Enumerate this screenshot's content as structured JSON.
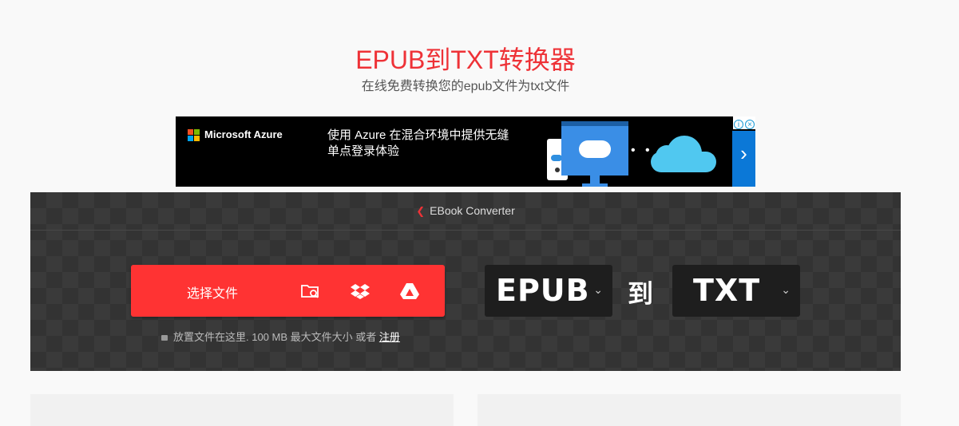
{
  "page": {
    "title": "EPUB到TXT转换器",
    "subtitle": "在线免费转换您的epub文件为txt文件"
  },
  "ad": {
    "brand": "Microsoft Azure",
    "text": "使用 Azure 在混合环境中提供无缝单点登录体验",
    "dots": "• • •",
    "arrow": "›",
    "logo_colors": [
      "#f25022",
      "#7fba00",
      "#00a4ef",
      "#ffb900"
    ]
  },
  "converter": {
    "breadcrumb": "EBook Converter",
    "select_label": "选择文件",
    "hint_text": "放置文件在这里. 100 MB 最大文件大小 或者",
    "hint_link": "注册",
    "from_format": "EPUB",
    "to_label": "到",
    "to_format": "TXT",
    "accent_color": "#ff3333"
  }
}
